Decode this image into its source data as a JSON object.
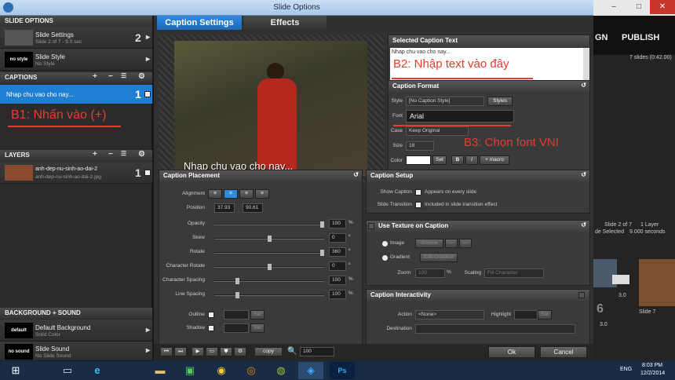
{
  "window": {
    "title": "Slide Options"
  },
  "bg_app": {
    "top_nav": "GN",
    "publish": "PUBLISH",
    "slides_count": "7 slides (0:42.00)",
    "slide_info": "Slide 2 of 7",
    "layer_info": "1 Layer",
    "selected_info": "de Selected",
    "duration": "9.000 seconds",
    "thumb_duration": "3.0",
    "thumb_number": "6",
    "slide7_label": "Slide 7",
    "thumb_duration2": "3.0"
  },
  "left": {
    "slide_options_header": "SLIDE OPTIONS",
    "slide_settings": {
      "title": "Slide Settings",
      "sub": "Slide 2 of 7 - 9.0 sec",
      "num": "2"
    },
    "slide_style": {
      "thumb": "no style",
      "title": "Slide Style",
      "sub": "No Style"
    },
    "captions_header": "CAPTIONS",
    "caption_item": {
      "text": "Nhap chu vao cho nay...",
      "num": "1"
    },
    "annotation_b1": "B1: Nhấn vào (+)",
    "layers_header": "LAYERS",
    "layer_item": {
      "title": "anh-dep-nu-sinh-ao-dai-2",
      "sub": "anh-dep-nu-sinh-ao-dai-2.jpg",
      "num": "1"
    },
    "bg_sound_header": "BACKGROUND + SOUND",
    "background": {
      "thumb": "default",
      "title": "Default Background",
      "sub": "Solid Color"
    },
    "sound": {
      "thumb": "no sound",
      "title": "Slide Sound",
      "sub": "No Slide Sound"
    }
  },
  "tabs": {
    "caption_settings": "Caption Settings",
    "effects": "Effects"
  },
  "preview": {
    "caption_overlay": "Nhap chu vao cho nay..."
  },
  "selected_caption": {
    "header": "Selected Caption Text",
    "text": "Nhap chu vao cho nay...",
    "annotation_b2": "B2: Nhập text vào đây"
  },
  "caption_format": {
    "header": "Caption Format",
    "style_label": "Style",
    "style_value": "[No Caption Style]",
    "styles_btn": "Styles",
    "font_label": "Font",
    "font_value": "Arial",
    "case_label": "Case",
    "case_value": "Keep Original",
    "size_label": "Size",
    "size_value": "18",
    "color_label": "Color",
    "set_btn": "Set",
    "bold_btn": "B",
    "italic_btn": "I",
    "macro_btn": "+ macro",
    "annotation_b3": "B3: Chọn font VNI"
  },
  "placement": {
    "header": "Caption Placement",
    "alignment_label": "Alignment",
    "position_label": "Position",
    "pos_x": "37.93",
    "pos_y": "90.61",
    "sliders": [
      {
        "label": "Opacity",
        "value": "100",
        "unit": "%",
        "level": 1.0
      },
      {
        "label": "Skew",
        "value": "0",
        "unit": "º",
        "level": 0.5
      },
      {
        "label": "Rotate",
        "value": "360",
        "unit": "º",
        "level": 1.0
      },
      {
        "label": "Character Rotate",
        "value": "0",
        "unit": "º",
        "level": 0.5
      },
      {
        "label": "Character Spacing",
        "value": "100",
        "unit": "%",
        "level": 0.2
      },
      {
        "label": "Line Spacing",
        "value": "100",
        "unit": "%",
        "level": 0.2
      }
    ],
    "outline_label": "Outline",
    "shadow_label": "Shadow",
    "set_btn": "Set"
  },
  "setup": {
    "header": "Caption Setup",
    "show_caption_label": "Show Caption",
    "show_caption_opt": "Appears on every slide",
    "transition_label": "Slide Transition",
    "transition_opt": "Included in slide transition effect"
  },
  "texture": {
    "header": "Use Texture on Caption",
    "image_label": "Image",
    "browse": "browse",
    "gradient_label": "Gradient",
    "edit_gradient": "Edit Gradient",
    "zoom_label": "Zoom",
    "zoom_value": "100",
    "scaling_label": "Scaling",
    "scaling_value": "Fill Character"
  },
  "interactivity": {
    "header": "Caption Interactivity",
    "action_label": "Action",
    "action_value": "<None>",
    "highlight_label": "Highlight",
    "set_btn": "Set",
    "destination_label": "Destination"
  },
  "bottom": {
    "copy": "copy",
    "zoom": "100",
    "ok": "Ok",
    "cancel": "Cancel"
  },
  "taskbar": {
    "lang": "ENG",
    "time": "8:03 PM",
    "date": "12/2/2014"
  }
}
